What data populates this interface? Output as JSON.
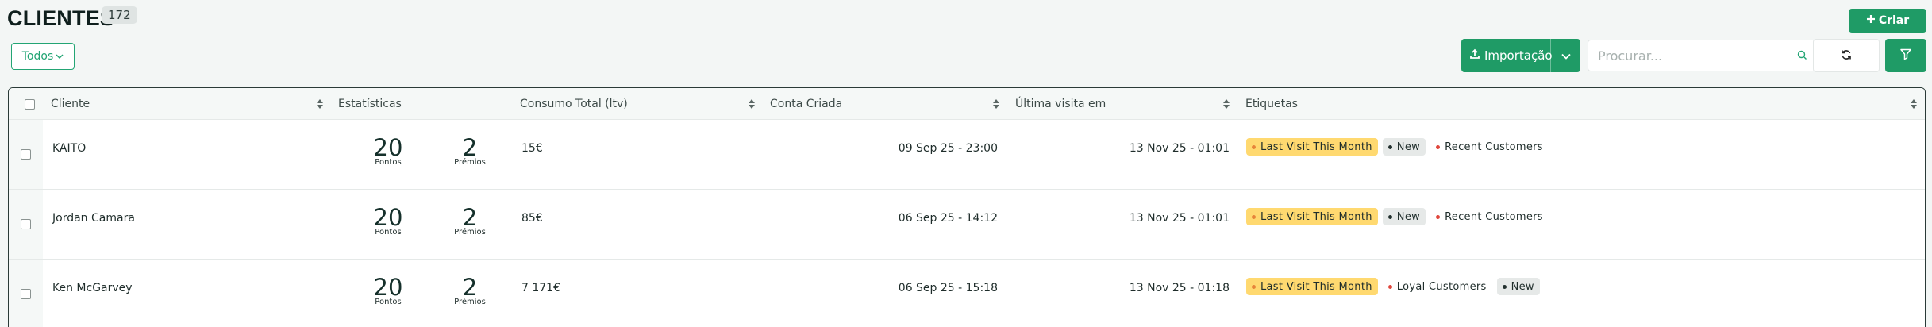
{
  "header": {
    "title": "CLIENTES",
    "count": "172",
    "create_label": "Criar"
  },
  "toolbar": {
    "filter_value": "Todos",
    "import_label": "Importação",
    "search_placeholder": "Procurar..."
  },
  "colors": {
    "accent": "#1f9b66",
    "tag_yellow": "#ffd970",
    "tag_gray": "#e6e9e8",
    "dot_red": "#e0463c",
    "dot_dark": "#22302e",
    "dot_yellow_tag": "#e7843a"
  },
  "table": {
    "columns": [
      {
        "label": "Cliente"
      },
      {
        "label": "Estatísticas"
      },
      {
        "label": "Consumo Total (ltv)"
      },
      {
        "label": "Conta Criada"
      },
      {
        "label": "Última visita em"
      },
      {
        "label": "Etiquetas"
      }
    ],
    "rows": [
      {
        "name": "KAITO",
        "points": "20",
        "points_label": "Pontos",
        "prizes": "2",
        "prizes_label": "Prémios",
        "ltv": "15€",
        "created": "09 Sep 25 - 23:00",
        "last_visit": "13 Nov 25 - 01:01",
        "tags": [
          {
            "label": "Last Visit This Month",
            "style": "yellow",
            "dot": "orange"
          },
          {
            "label": "New",
            "style": "gray",
            "dot": "dark"
          },
          {
            "label": "Recent Customers",
            "style": "plain",
            "dot": "red"
          }
        ]
      },
      {
        "name": "Jordan Camara",
        "points": "20",
        "points_label": "Pontos",
        "prizes": "2",
        "prizes_label": "Prémios",
        "ltv": "85€",
        "created": "06 Sep 25 - 14:12",
        "last_visit": "13 Nov 25 - 01:01",
        "tags": [
          {
            "label": "Last Visit This Month",
            "style": "yellow",
            "dot": "orange"
          },
          {
            "label": "New",
            "style": "gray",
            "dot": "dark"
          },
          {
            "label": "Recent Customers",
            "style": "plain",
            "dot": "red"
          }
        ]
      },
      {
        "name": "Ken McGarvey",
        "points": "20",
        "points_label": "Pontos",
        "prizes": "2",
        "prizes_label": "Prémios",
        "ltv": "7 171€",
        "created": "06 Sep 25 - 15:18",
        "last_visit": "13 Nov 25 - 01:18",
        "tags": [
          {
            "label": "Last Visit This Month",
            "style": "yellow",
            "dot": "orange"
          },
          {
            "label": "Loyal Customers",
            "style": "plain",
            "dot": "red"
          },
          {
            "label": "New",
            "style": "gray",
            "dot": "dark"
          }
        ]
      }
    ]
  }
}
